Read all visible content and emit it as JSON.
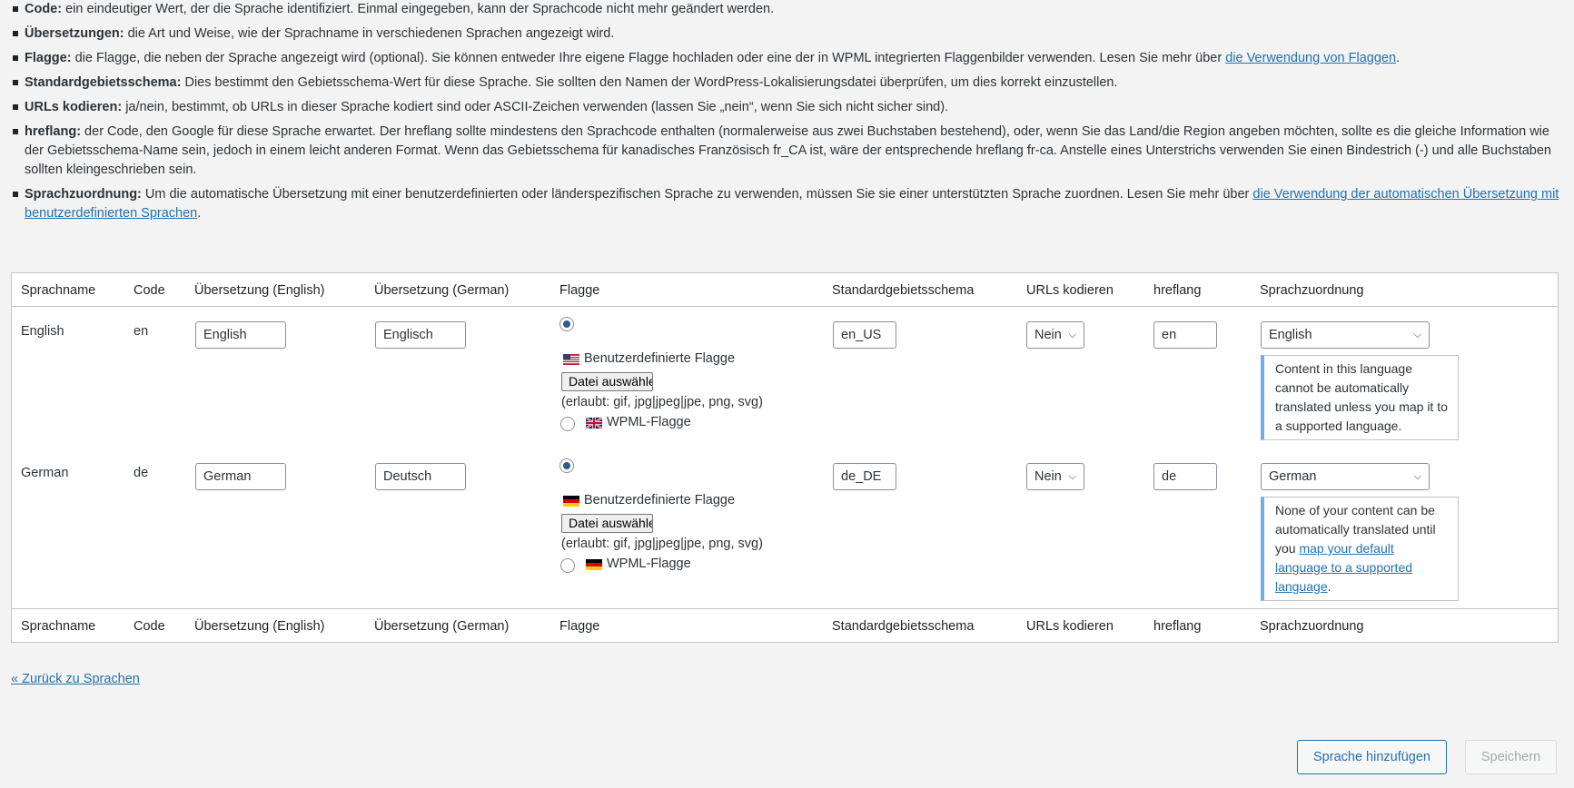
{
  "help": {
    "code": {
      "term": "Code:",
      "text": " ein eindeutiger Wert, der die Sprache identifiziert. Einmal eingegeben, kann der Sprachcode nicht mehr geändert werden."
    },
    "translations": {
      "term": "Übersetzungen:",
      "text": " die Art und Weise, wie der Sprachname in verschiedenen Sprachen angezeigt wird."
    },
    "flag": {
      "term": "Flagge:",
      "text": " die Flagge, die neben der Sprache angezeigt wird (optional). Sie können entweder Ihre eigene Flagge hochladen oder eine der in WPML integrierten Flaggenbilder verwenden. Lesen Sie mehr über ",
      "link": "die Verwendung von Flaggen",
      "after": "."
    },
    "locale": {
      "term": "Standardgebietsschema:",
      "text": " Dies bestimmt den Gebietsschema-Wert für diese Sprache. Sie sollten den Namen der WordPress-Lokalisierungsdatei überprüfen, um dies korrekt einzustellen."
    },
    "encode": {
      "term": "URLs kodieren:",
      "text": " ja/nein, bestimmt, ob URLs in dieser Sprache kodiert sind oder ASCII-Zeichen verwenden (lassen Sie „nein“, wenn Sie sich nicht sicher sind)."
    },
    "hreflang": {
      "term": "hreflang:",
      "text": " der Code, den Google für diese Sprache erwartet. Der hreflang sollte mindestens den Sprachcode enthalten (normalerweise aus zwei Buchstaben bestehend), oder, wenn Sie das Land/die Region angeben möchten, sollte es die gleiche Information wie der Gebietsschema-Name sein, jedoch in einem leicht anderen Format. Wenn das Gebietsschema für kanadisches Französisch fr_CA ist, wäre der entsprechende hreflang fr-ca. Anstelle eines Unterstrichs verwenden Sie einen Bindestrich (-) und alle Buchstaben sollten kleingeschrieben sein."
    },
    "mapping": {
      "term": "Sprachzuordnung:",
      "text": " Um die automatische Übersetzung mit einer benutzerdefinierten oder länderspezifischen Sprache zu verwenden, müssen Sie sie einer unterstützten Sprache zuordnen. Lesen Sie mehr über ",
      "link": "die Verwendung der automatischen Übersetzung mit benutzerdefinierten Sprachen",
      "after": "."
    }
  },
  "columns": {
    "name": "Sprachname",
    "code": "Code",
    "trans_en": "Übersetzung (English)",
    "trans_de": "Übersetzung (German)",
    "flag": "Flagge",
    "locale": "Standardgebietsschema",
    "encode": "URLs kodieren",
    "hreflang": "hreflang",
    "mapping": "Sprachzuordnung"
  },
  "rows": [
    {
      "name": "English",
      "code": "en",
      "trans_en": "English",
      "trans_de": "Englisch",
      "custom_flag_label": "Benutzerdefinierte Flagge",
      "file_button": "Datei auswählen",
      "allowed": "(erlaubt: gif, jpg|jpeg|jpe, png, svg)",
      "wpml_flag_label": "WPML-Flagge",
      "locale": "en_US",
      "encode": "Nein",
      "hreflang": "en",
      "mapping": "English",
      "notice": "Content in this language cannot be automatically translated unless you map it to a supported language."
    },
    {
      "name": "German",
      "code": "de",
      "trans_en": "German",
      "trans_de": "Deutsch",
      "custom_flag_label": "Benutzerdefinierte Flagge",
      "file_button": "Datei auswählen",
      "allowed": "(erlaubt: gif, jpg|jpeg|jpe, png, svg)",
      "wpml_flag_label": "WPML-Flagge",
      "locale": "de_DE",
      "encode": "Nein",
      "hreflang": "de",
      "mapping": "German",
      "notice_before": "None of your content can be automatically translated until you ",
      "notice_link": "map your default language to a supported language",
      "notice_after": "."
    }
  ],
  "back_link": "« Zurück zu Sprachen",
  "buttons": {
    "add": "Sprache hinzufügen",
    "save": "Speichern"
  },
  "colors": {
    "link": "#2271b1",
    "radio_checked": "#2a5e8c",
    "notice_border": "#72aee6"
  }
}
